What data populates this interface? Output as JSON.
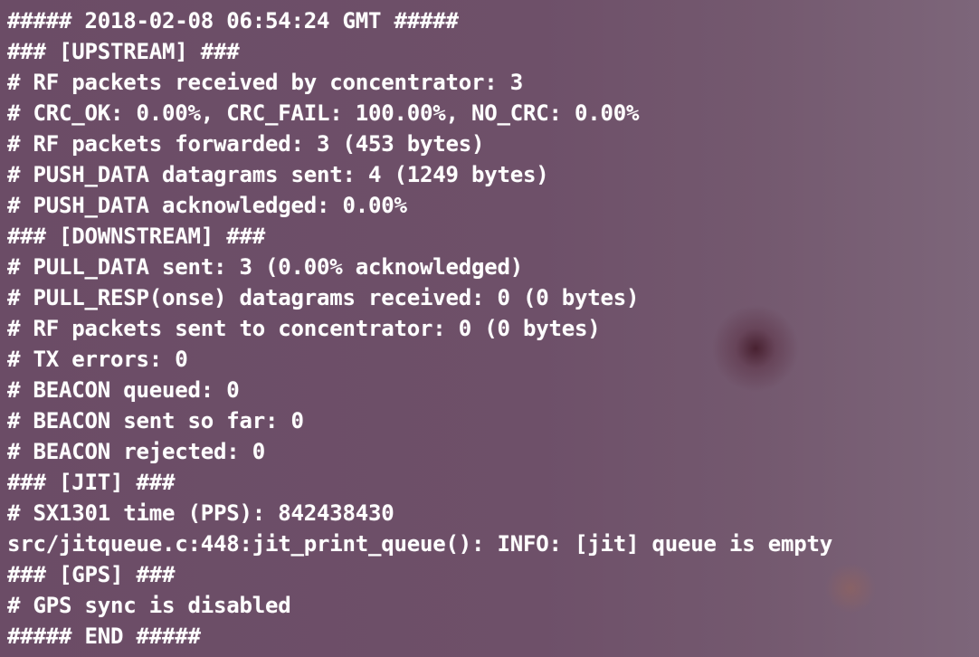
{
  "terminal": {
    "lines": [
      "##### 2018-02-08 06:54:24 GMT #####",
      "### [UPSTREAM] ###",
      "# RF packets received by concentrator: 3",
      "# CRC_OK: 0.00%, CRC_FAIL: 100.00%, NO_CRC: 0.00%",
      "# RF packets forwarded: 3 (453 bytes)",
      "# PUSH_DATA datagrams sent: 4 (1249 bytes)",
      "# PUSH_DATA acknowledged: 0.00%",
      "### [DOWNSTREAM] ###",
      "# PULL_DATA sent: 3 (0.00% acknowledged)",
      "# PULL_RESP(onse) datagrams received: 0 (0 bytes)",
      "# RF packets sent to concentrator: 0 (0 bytes)",
      "# TX errors: 0",
      "# BEACON queued: 0",
      "# BEACON sent so far: 0",
      "# BEACON rejected: 0",
      "### [JIT] ###",
      "# SX1301 time (PPS): 842438430",
      "src/jitqueue.c:448:jit_print_queue(): INFO: [jit] queue is empty",
      "### [GPS] ###",
      "# GPS sync is disabled",
      "##### END #####"
    ]
  },
  "background": {
    "base_color": "#6e5269"
  }
}
